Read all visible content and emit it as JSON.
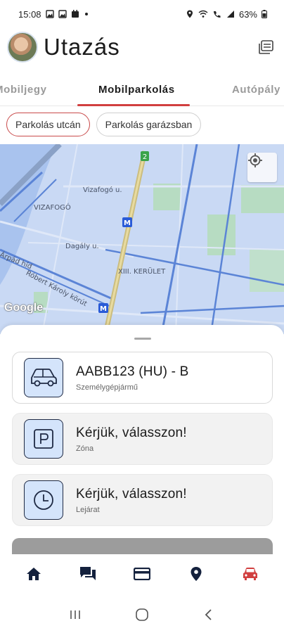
{
  "status_bar": {
    "time": "15:08",
    "battery": "63%"
  },
  "header": {
    "title": "Utazás"
  },
  "tabs": [
    {
      "label": "Mobiljegy"
    },
    {
      "label": "Mobilparkolás"
    },
    {
      "label": "Autópály"
    }
  ],
  "chips": [
    {
      "label": "Parkolás utcán"
    },
    {
      "label": "Parkolás garázsban"
    }
  ],
  "map": {
    "labels": [
      "VIZAFOGÓ",
      "Vizafogó u.",
      "Dagály u.",
      "XIII. KERÜLET",
      "Árpád híd",
      "Róbert Károly körút"
    ],
    "attribution": "Google",
    "metro_badge": "M",
    "route_badge": "2"
  },
  "cards": [
    {
      "title": "AABB123 (HU) - B",
      "subtitle": "Személygépjármű",
      "icon": "car-icon"
    },
    {
      "title": "Kérjük, válasszon!",
      "subtitle": "Zóna",
      "icon": "parking-icon"
    },
    {
      "title": "Kérjük, válasszon!",
      "subtitle": "Lejárat",
      "icon": "clock-icon"
    }
  ],
  "bottom_nav": [
    {
      "icon": "home-icon"
    },
    {
      "icon": "chat-icon"
    },
    {
      "icon": "card-icon"
    },
    {
      "icon": "location-icon"
    },
    {
      "icon": "car-icon",
      "active": true
    }
  ],
  "colors": {
    "accent": "#d13f3f",
    "nav": "#14213d",
    "icon_bg": "#d4e4fb",
    "map_bg": "#c9d9f4"
  }
}
